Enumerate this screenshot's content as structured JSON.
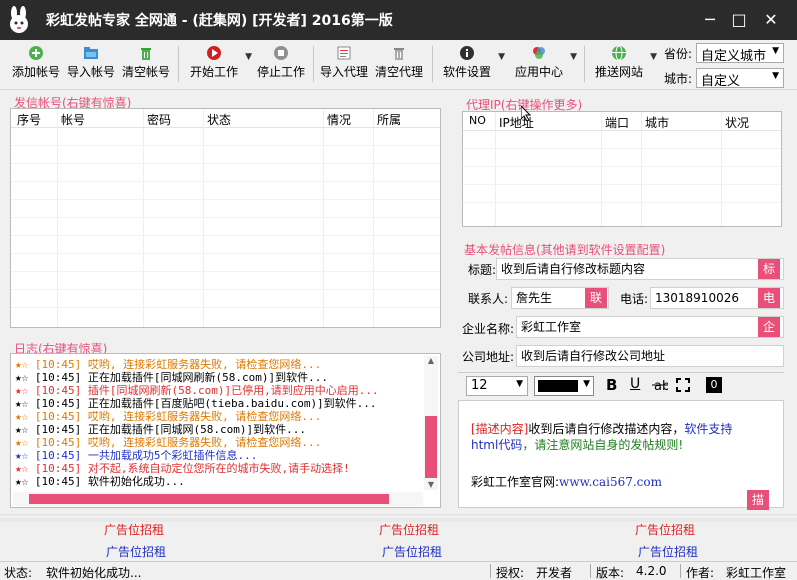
{
  "titlebar": {
    "title": "彩虹发帖专家 全网通 - (赶集网) [开发者]  2016第一版",
    "minimize": "─",
    "maximize": "□",
    "close": "✕"
  },
  "toolbar": {
    "add_account": "添加帐号",
    "import_account": "导入帐号",
    "clear_account": "清空帐号",
    "start_work": "开始工作",
    "stop_work": "停止工作",
    "import_proxy": "导入代理",
    "clear_proxy": "清空代理",
    "software_settings": "软件设置",
    "app_center": "应用中心",
    "push_site": "推送网站",
    "province_label": "省份:",
    "province_value": "自定义城市",
    "city_label": "城市:",
    "city_value": "自定义"
  },
  "accounts": {
    "title": "发信帐号(右键有惊喜)",
    "columns": [
      "序号",
      "帐号",
      "密码",
      "状态",
      "情况",
      "所属"
    ]
  },
  "proxy": {
    "title": "代理IP(右键操作更多)",
    "columns": [
      "NO",
      "IP地址",
      "端口",
      "城市",
      "状况"
    ]
  },
  "basic_info": {
    "title": "基本发帖信息(其他请到软件设置配置)",
    "title_label": "标题:",
    "title_value": "收到后请自行修改标题内容",
    "title_tag": "标",
    "contact_label": "联系人:",
    "contact_value": "詹先生",
    "contact_tag": "联",
    "phone_label": "电话:",
    "phone_value": "13018910026",
    "phone_tag": "电",
    "company_label": "企业名称:",
    "company_value": "彩虹工作室",
    "company_tag": "企",
    "address_label": "公司地址:",
    "address_value": "收到后请自行修改公司地址"
  },
  "editor": {
    "font_size": "12",
    "bold": "B",
    "underline": "U",
    "zero": "0",
    "desc_prefix": "[描述内容]",
    "desc_text1": "收到后请自行修改描述内容，",
    "desc_html_support": "软件支持",
    "desc_html_code": "html代码",
    "desc_text2": "，请注意网站自身的发帖规则!",
    "site_label": "彩虹工作室官网:",
    "site_url": "www.cai567.com",
    "desc_tag": "描"
  },
  "log": {
    "title": "日志(右键有惊喜)",
    "entries": [
      {
        "stars": "★☆",
        "text": "[10:45] 哎哟, 连接彩虹服务器失败, 请检查您网络...",
        "color": "#e07800",
        "star_color": "#e07800"
      },
      {
        "stars": "★☆",
        "text": "[10:45] 正在加载插件[同城网刷新(58.com)]到软件...",
        "color": "#000000",
        "star_color": "#000000"
      },
      {
        "stars": "★☆",
        "text": "[10:45] 插件[同城网刷新(58.com)]已停用,请到应用中心启用...",
        "color": "#e03030",
        "star_color": "#e03030"
      },
      {
        "stars": "★☆",
        "text": "[10:45] 正在加载插件[百度贴吧(tieba.baidu.com)]到软件...",
        "color": "#000000",
        "star_color": "#000000"
      },
      {
        "stars": "★☆",
        "text": "[10:45] 哎哟, 连接彩虹服务器失败, 请检查您网络...",
        "color": "#e07800",
        "star_color": "#e07800"
      },
      {
        "stars": "★☆",
        "text": "[10:45] 正在加载插件[同城网(58.com)]到软件...",
        "color": "#000000",
        "star_color": "#000000"
      },
      {
        "stars": "★☆",
        "text": "[10:45] 哎哟, 连接彩虹服务器失败, 请检查您网络...",
        "color": "#e07800",
        "star_color": "#e07800"
      },
      {
        "stars": "★☆",
        "text": "[10:45] 一共加载成功5个彩虹插件信息...",
        "color": "#2030d0",
        "star_color": "#2030d0"
      },
      {
        "stars": "★☆",
        "text": "[10:45] 对不起,系统自动定位您所在的城市失败,请手动选择!",
        "color": "#e03030",
        "star_color": "#e03030"
      },
      {
        "stars": "★☆",
        "text": "[10:45] 软件初始化成功...",
        "color": "#000000",
        "star_color": "#000000"
      }
    ]
  },
  "ads": {
    "red": "广告位招租",
    "blue": "广告位招租"
  },
  "statusbar": {
    "status_label": "状态:",
    "status_value": "软件初始化成功...",
    "auth_label": "授权:",
    "auth_value": "开发者",
    "version_label": "版本:",
    "version_value": "4.2.0",
    "author_label": "作者:",
    "author_value": "彩虹工作室"
  },
  "colors": {
    "accent_pink": "#e8507a",
    "titlebar": "#2b2b2b",
    "ad_red": "#e02020",
    "ad_blue": "#2030c0"
  }
}
